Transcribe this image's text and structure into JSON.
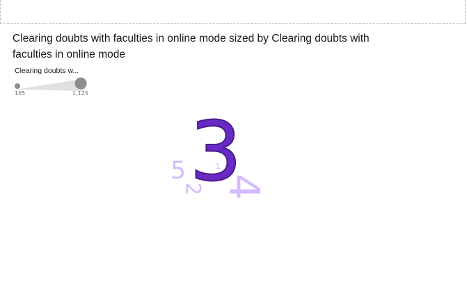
{
  "chart_data": {
    "type": "wordcloud",
    "title": "Clearing doubts with faculties in online mode sized by Clearing doubts with faculties in online mode",
    "size_legend": {
      "label": "Clearing doubts w...",
      "min_label": "165",
      "max_label": "1,125",
      "min": 165,
      "max": 1125
    },
    "words": [
      {
        "text": "3",
        "value": 1125,
        "color": "#6929c4",
        "rotated": false
      },
      {
        "text": "4",
        "value": 600,
        "color": "#d4bbff",
        "rotated": true
      },
      {
        "text": "5",
        "value": 380,
        "color": "#d4bbff",
        "rotated": false
      },
      {
        "text": "2",
        "value": 330,
        "color": "#d4bbff",
        "rotated": true
      },
      {
        "text": "1",
        "value": 165,
        "color": "#d4bbff",
        "rotated": false
      }
    ]
  },
  "colors": {
    "accent": "#6929c4",
    "accent_stroke": "#491d8b",
    "secondary": "#d4bbff",
    "legend_gray": "#8d8d8d"
  }
}
